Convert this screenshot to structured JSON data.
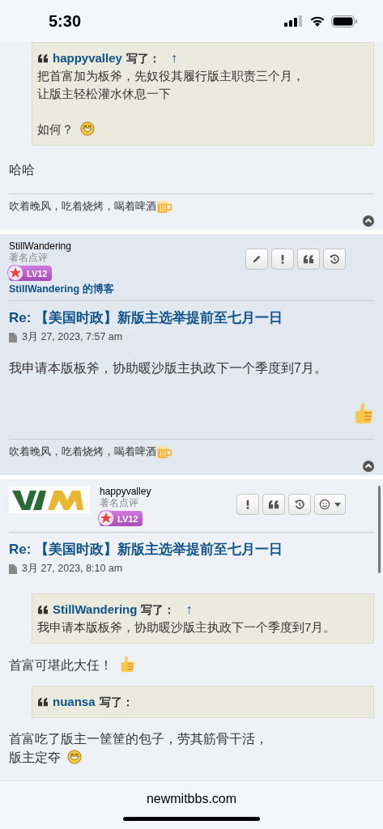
{
  "status_bar": {
    "time": "5:30"
  },
  "posts": [
    {
      "content": [
        {
          "kind": "quote",
          "author": "happyvalley",
          "says": "写了：",
          "jump": "↑",
          "paragraphs": [
            {
              "lines": [
                "把首富加为板斧，先奴役其履行版主职责三个月，",
                "让版主轻松灌水休息一下"
              ]
            },
            {
              "lines": [
                "如何？"
              ],
              "trail": {
                "kind": "grin"
              }
            }
          ]
        },
        {
          "kind": "text",
          "lines": [
            "哈哈"
          ]
        }
      ],
      "signature": "吹着晚风，吃着烧烤，喝着啤酒"
    },
    {
      "author": "StillWandering",
      "rank": "著名点评",
      "badge": "LV12",
      "blog": "StillWandering 的博客",
      "actions": [
        {
          "kind": "edit"
        },
        {
          "kind": "report"
        },
        {
          "kind": "quote"
        },
        {
          "kind": "history"
        }
      ],
      "title": "Re: 【美国时政】新版主选举提前至七月一日",
      "date": "3月 27, 2023, 7:57 am",
      "content": [
        {
          "kind": "text",
          "lines": [
            "我申请本版板斧，协助暖沙版主执政下一个季度到7月。"
          ]
        },
        {
          "kind": "reaction"
        }
      ],
      "signature": "吹着晚风，吃着烧烤，喝着啤酒"
    },
    {
      "author": "happyvalley",
      "rank": "著名点评",
      "badge": "LV12",
      "actions": [
        {
          "kind": "report"
        },
        {
          "kind": "quote"
        },
        {
          "kind": "history"
        },
        {
          "kind": "react"
        }
      ],
      "title": "Re: 【美国时政】新版主选举提前至七月一日",
      "date": "3月 27, 2023, 8:10 am",
      "content": [
        {
          "kind": "quote",
          "author": "StillWandering",
          "says": "写了：",
          "jump": "↑",
          "paragraphs": [
            {
              "lines": [
                "我申请本版板斧，协助暖沙版主执政下一个季度到7月。"
              ]
            }
          ]
        },
        {
          "kind": "text",
          "lines": [
            "首富可堪此大任！"
          ],
          "trail": {
            "kind": "thumbs-up"
          }
        },
        {
          "kind": "quote",
          "author": "nuansa",
          "says": "写了："
        },
        {
          "kind": "text",
          "lines": [
            "首富吃了版主一筐筐的包子，劳其筋骨干活，",
            "版主定夺"
          ],
          "trail": {
            "kind": "grin"
          }
        }
      ]
    }
  ],
  "address_bar": {
    "url": "newmitbbs.com"
  }
}
